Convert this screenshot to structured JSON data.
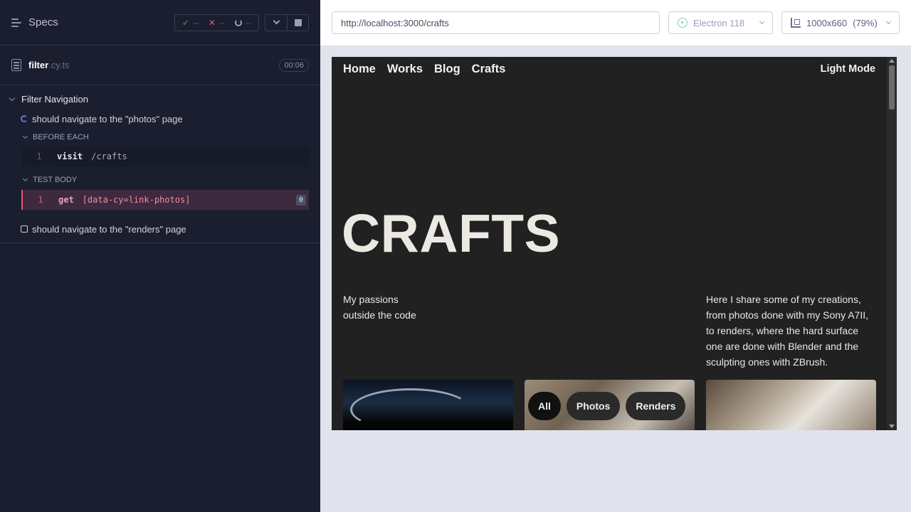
{
  "reporter": {
    "title": "Specs",
    "stats": {
      "passed": "--",
      "failed": "--",
      "pending": "--"
    },
    "file": {
      "name": "filter",
      "ext": ".cy.ts",
      "timer": "00:06"
    },
    "suite": {
      "title": "Filter Navigation",
      "tests": [
        {
          "title": "should navigate to the \"photos\" page",
          "state": "running",
          "hooks": [
            {
              "title": "BEFORE EACH",
              "commands": [
                {
                  "num": "1",
                  "name": "visit",
                  "arg": "/crafts"
                }
              ]
            },
            {
              "title": "TEST BODY",
              "commands": [
                {
                  "num": "1",
                  "name": "get",
                  "arg": "[data-cy=link-photos]",
                  "badge": "0"
                }
              ]
            }
          ]
        },
        {
          "title": "should navigate to the \"renders\" page",
          "state": "pending"
        }
      ]
    }
  },
  "aut": {
    "url": "http://localhost:3000/crafts",
    "browser": "Electron 118",
    "viewport": "1000x660",
    "zoom": "(79%)"
  },
  "site": {
    "nav": [
      "Home",
      "Works",
      "Blog",
      "Crafts"
    ],
    "light_mode": "Light Mode",
    "hero": "CRAFTS",
    "passions_line1": "My passions",
    "passions_line2": "outside the code",
    "intro": "Here I share some of my creations, from photos done with my Sony A7II, to renders, where the hard surface one are done with Blender and the sculpting ones with ZBrush.",
    "filters": [
      "All",
      "Photos",
      "Renders"
    ]
  },
  "colors": {
    "accent_pass": "#2bb673",
    "accent_fail": "#e45770",
    "reporter_bg": "#1b1e2e",
    "site_bg": "#212121"
  }
}
